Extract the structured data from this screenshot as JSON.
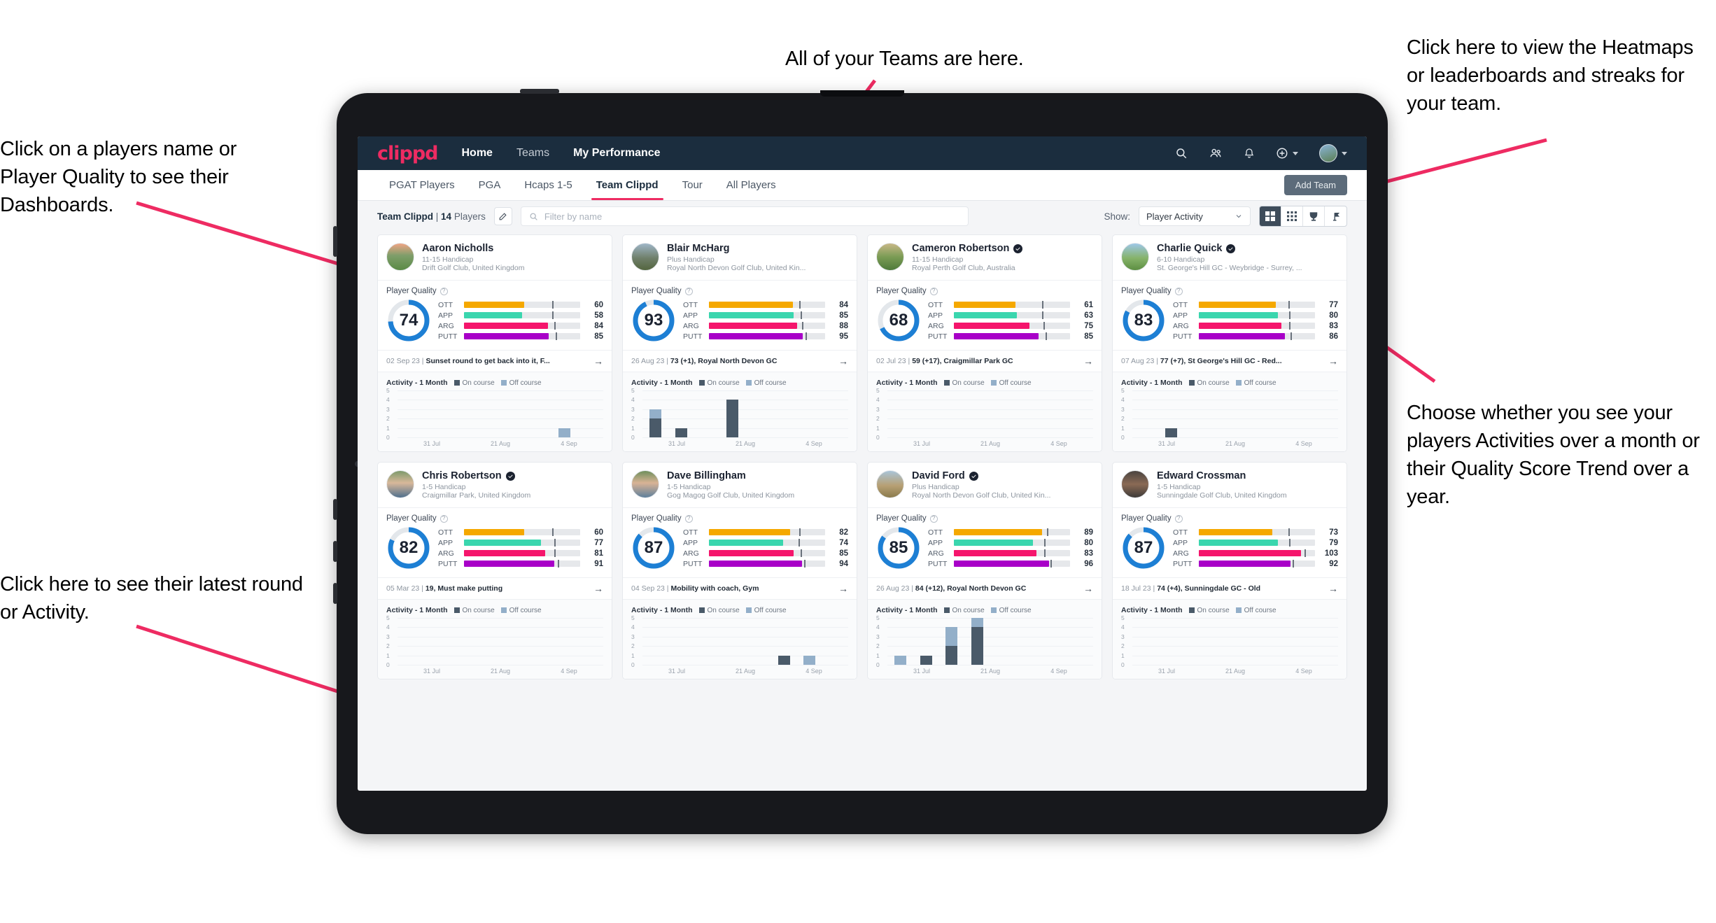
{
  "annotations": [
    {
      "id": "players-name",
      "text": "Click on a players name or Player Quality to see their Dashboards."
    },
    {
      "id": "teams",
      "text": "All of your Teams are here."
    },
    {
      "id": "heatmaps",
      "text": "Click here to view the Heatmaps or leaderboards and streaks for your team."
    },
    {
      "id": "activity-toggle",
      "text": "Choose whether you see your players Activities over a month or their Quality Score Trend over a year."
    },
    {
      "id": "latest-round",
      "text": "Click here to see their latest round or Activity."
    }
  ],
  "navbar": {
    "logo": "clippd",
    "links": [
      {
        "label": "Home",
        "active": true
      },
      {
        "label": "Teams",
        "active": false
      },
      {
        "label": "My Performance",
        "active": true
      }
    ],
    "icons": [
      "search-icon",
      "people-icon",
      "bell-icon",
      "plus-circle-icon",
      "avatar"
    ]
  },
  "tabs": [
    {
      "label": "PGAT Players",
      "active": false
    },
    {
      "label": "PGA",
      "active": false
    },
    {
      "label": "Hcaps 1-5",
      "active": false
    },
    {
      "label": "Team Clippd",
      "active": true
    },
    {
      "label": "Tour",
      "active": false
    },
    {
      "label": "All Players",
      "active": false
    }
  ],
  "add_team_label": "Add Team",
  "toolbar": {
    "team_name": "Team Clippd",
    "player_count": "14",
    "players_word": "Players",
    "team_label": "Team Clippd | 14 Players",
    "edit_icon": "pencil-icon",
    "search_placeholder": "Filter by name",
    "search_value": "",
    "show_label": "Show:",
    "show_value": "Player Activity",
    "show_options": [
      "Player Activity",
      "Quality Score Trend"
    ],
    "view_buttons": [
      "grid-large-icon",
      "grid-small-icon",
      "trophy-icon",
      "flag-icon"
    ],
    "active_view": "grid-large-icon"
  },
  "card_labels": {
    "player_quality": "Player Quality",
    "activity": "Activity - 1 Month",
    "legend_on": "On course",
    "legend_off": "Off course",
    "metric_names": [
      "OTT",
      "APP",
      "ARG",
      "PUTT"
    ],
    "y_ticks": [
      "5",
      "4",
      "3",
      "2",
      "1",
      "0"
    ],
    "x_ticks": [
      "31 Jul",
      "21 Aug",
      "4 Sep"
    ]
  },
  "colors": {
    "brand_pink": "#ee2b62",
    "navy": "#1b2d3e",
    "ring_blue": "#1d7fd4",
    "ott": "#f5a800",
    "app": "#3ad6ae",
    "arg": "#f5156c",
    "putt": "#a800c8",
    "on_course": "#4a5a69",
    "off_course": "#93afc9"
  },
  "players": [
    {
      "name": "Aaron Nicholls",
      "verified": false,
      "handicap": "11-15 Handicap",
      "club": "Drift Golf Club, United Kingdom",
      "quality_score": 74,
      "metrics": [
        {
          "name": "OTT",
          "value": 60,
          "fill": 52,
          "tick": 76
        },
        {
          "name": "APP",
          "value": 58,
          "fill": 50,
          "tick": 76
        },
        {
          "name": "ARG",
          "value": 84,
          "fill": 72,
          "tick": 78
        },
        {
          "name": "PUTT",
          "value": 85,
          "fill": 73,
          "tick": 79
        }
      ],
      "latest_date": "02 Sep 23",
      "latest_text": "Sunset round to get back into it, F...",
      "avatar_style": "course-sunset",
      "chart": {
        "type": "bar",
        "values_on": [
          0,
          0,
          0,
          0,
          0,
          0,
          0,
          0
        ],
        "values_off": [
          0,
          0,
          0,
          0,
          0,
          0,
          1,
          0
        ],
        "ymax": 5
      }
    },
    {
      "name": "Blair McHarg",
      "verified": false,
      "handicap": "Plus Handicap",
      "club": "Royal North Devon Golf Club, United Kin...",
      "quality_score": 93,
      "metrics": [
        {
          "name": "OTT",
          "value": 84,
          "fill": 72,
          "tick": 78
        },
        {
          "name": "APP",
          "value": 85,
          "fill": 73,
          "tick": 79
        },
        {
          "name": "ARG",
          "value": 88,
          "fill": 76,
          "tick": 80
        },
        {
          "name": "PUTT",
          "value": 95,
          "fill": 81,
          "tick": 83
        }
      ],
      "latest_date": "26 Aug 23",
      "latest_text": "73 (+1), Royal North Devon GC",
      "avatar_style": "course-links",
      "chart": {
        "type": "bar",
        "values_on": [
          2,
          1,
          0,
          4,
          0,
          0,
          0,
          0
        ],
        "values_off": [
          1,
          0,
          0,
          0,
          0,
          0,
          0,
          0
        ],
        "ymax": 5
      }
    },
    {
      "name": "Cameron Robertson",
      "verified": true,
      "handicap": "11-15 Handicap",
      "club": "Royal Perth Golf Club, Australia",
      "quality_score": 68,
      "metrics": [
        {
          "name": "OTT",
          "value": 61,
          "fill": 53,
          "tick": 76
        },
        {
          "name": "APP",
          "value": 63,
          "fill": 54,
          "tick": 76
        },
        {
          "name": "ARG",
          "value": 75,
          "fill": 65,
          "tick": 77
        },
        {
          "name": "PUTT",
          "value": 85,
          "fill": 73,
          "tick": 79
        }
      ],
      "latest_date": "02 Jul 23",
      "latest_text": "59 (+17), Craigmillar Park GC",
      "avatar_style": "course-tree",
      "chart": {
        "type": "bar",
        "values_on": [
          0,
          0,
          0,
          0,
          0,
          0,
          0,
          0
        ],
        "values_off": [
          0,
          0,
          0,
          0,
          0,
          0,
          0,
          0
        ],
        "ymax": 5
      }
    },
    {
      "name": "Charlie Quick",
      "verified": true,
      "handicap": "6-10 Handicap",
      "club": "St. George's Hill GC - Weybridge - Surrey, ...",
      "quality_score": 83,
      "metrics": [
        {
          "name": "OTT",
          "value": 77,
          "fill": 66,
          "tick": 77
        },
        {
          "name": "APP",
          "value": 80,
          "fill": 68,
          "tick": 78
        },
        {
          "name": "ARG",
          "value": 83,
          "fill": 71,
          "tick": 78
        },
        {
          "name": "PUTT",
          "value": 86,
          "fill": 74,
          "tick": 79
        }
      ],
      "latest_date": "07 Aug 23",
      "latest_text": "77 (+7), St George's Hill GC - Red...",
      "avatar_style": "course-green",
      "chart": {
        "type": "bar",
        "values_on": [
          0,
          1,
          0,
          0,
          0,
          0,
          0,
          0
        ],
        "values_off": [
          0,
          0,
          0,
          0,
          0,
          0,
          0,
          0
        ],
        "ymax": 5
      }
    },
    {
      "name": "Chris Robertson",
      "verified": true,
      "handicap": "1-5 Handicap",
      "club": "Craigmillar Park, United Kingdom",
      "quality_score": 82,
      "metrics": [
        {
          "name": "OTT",
          "value": 60,
          "fill": 52,
          "tick": 76
        },
        {
          "name": "APP",
          "value": 77,
          "fill": 66,
          "tick": 78
        },
        {
          "name": "ARG",
          "value": 81,
          "fill": 70,
          "tick": 78
        },
        {
          "name": "PUTT",
          "value": 91,
          "fill": 78,
          "tick": 81
        }
      ],
      "latest_date": "05 Mar 23",
      "latest_text": "19, Must make putting",
      "avatar_style": "person-a",
      "chart": {
        "type": "bar",
        "values_on": [
          0,
          0,
          0,
          0,
          0,
          0,
          0,
          0
        ],
        "values_off": [
          0,
          0,
          0,
          0,
          0,
          0,
          0,
          0
        ],
        "ymax": 5
      }
    },
    {
      "name": "Dave Billingham",
      "verified": false,
      "handicap": "1-5 Handicap",
      "club": "Gog Magog Golf Club, United Kingdom",
      "quality_score": 87,
      "metrics": [
        {
          "name": "OTT",
          "value": 82,
          "fill": 70,
          "tick": 78
        },
        {
          "name": "APP",
          "value": 74,
          "fill": 64,
          "tick": 77
        },
        {
          "name": "ARG",
          "value": 85,
          "fill": 73,
          "tick": 79
        },
        {
          "name": "PUTT",
          "value": 94,
          "fill": 80,
          "tick": 82
        }
      ],
      "latest_date": "04 Sep 23",
      "latest_text": "Mobility with coach, Gym",
      "avatar_style": "person-b",
      "chart": {
        "type": "bar",
        "values_on": [
          0,
          0,
          0,
          0,
          0,
          1,
          0,
          0
        ],
        "values_off": [
          0,
          0,
          0,
          0,
          0,
          0,
          1,
          0
        ],
        "ymax": 5
      }
    },
    {
      "name": "David Ford",
      "verified": true,
      "handicap": "Plus Handicap",
      "club": "Royal North Devon Golf Club, United Kin...",
      "quality_score": 85,
      "metrics": [
        {
          "name": "OTT",
          "value": 89,
          "fill": 76,
          "tick": 80
        },
        {
          "name": "APP",
          "value": 80,
          "fill": 68,
          "tick": 78
        },
        {
          "name": "ARG",
          "value": 83,
          "fill": 71,
          "tick": 78
        },
        {
          "name": "PUTT",
          "value": 96,
          "fill": 82,
          "tick": 83
        }
      ],
      "latest_date": "26 Aug 23",
      "latest_text": "84 (+12), Royal North Devon GC",
      "avatar_style": "course-walker",
      "chart": {
        "type": "bar",
        "values_on": [
          0,
          1,
          2,
          4,
          0,
          0,
          0,
          0
        ],
        "values_off": [
          1,
          0,
          2,
          1,
          0,
          0,
          0,
          0
        ],
        "ymax": 5
      }
    },
    {
      "name": "Edward Crossman",
      "verified": false,
      "handicap": "1-5 Handicap",
      "club": "Sunningdale Golf Club, United Kingdom",
      "quality_score": 87,
      "metrics": [
        {
          "name": "OTT",
          "value": 73,
          "fill": 63,
          "tick": 77
        },
        {
          "name": "APP",
          "value": 79,
          "fill": 68,
          "tick": 78
        },
        {
          "name": "ARG",
          "value": 103,
          "fill": 88,
          "tick": 91
        },
        {
          "name": "PUTT",
          "value": 92,
          "fill": 79,
          "tick": 81
        }
      ],
      "latest_date": "18 Jul 23",
      "latest_text": "74 (+4), Sunningdale GC - Old",
      "avatar_style": "person-c",
      "chart": {
        "type": "bar",
        "values_on": [
          0,
          0,
          0,
          0,
          0,
          0,
          0,
          0
        ],
        "values_off": [
          0,
          0,
          0,
          0,
          0,
          0,
          0,
          0
        ],
        "ymax": 5
      }
    }
  ]
}
